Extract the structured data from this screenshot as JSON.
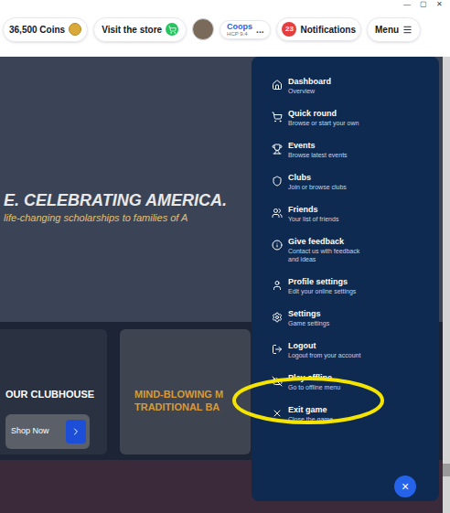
{
  "window_controls": [
    "—",
    "▢",
    "✕"
  ],
  "top_bar": {
    "coins": "36,500 Coins",
    "store": "Visit the store",
    "profile": {
      "name": "Coops",
      "handicap": "HCP 9.4",
      "more": "..."
    },
    "notifications": {
      "count": "23",
      "label": "Notifications"
    },
    "menu": "Menu"
  },
  "hero": {
    "title": "E. CELEBRATING AMERICA.",
    "subtitle": "life-changing scholarships to families of A"
  },
  "cards": [
    {
      "title": "OUR CLUBHOUSE",
      "button": "Shop Now"
    },
    {
      "lines": [
        "MIND-BLOWING M",
        "TRADITIONAL BA"
      ]
    }
  ],
  "menu_items": [
    {
      "title": "Dashboard",
      "description": "Overview",
      "highlighted": false
    },
    {
      "title": "Quick round",
      "description": "Browse or start your own",
      "highlighted": false
    },
    {
      "title": "Events",
      "description": "Browse latest events",
      "highlighted": false
    },
    {
      "title": "Clubs",
      "description": "Join or browse clubs",
      "highlighted": false
    },
    {
      "title": "Friends",
      "description": "Your list of friends",
      "highlighted": false
    },
    {
      "title": "Give feedback",
      "description": "Contact us with feedback and ideas",
      "highlighted": false
    },
    {
      "title": "Profile settings",
      "description": "Edit your online settings",
      "highlighted": false
    },
    {
      "title": "Settings",
      "description": "Game settings",
      "highlighted": false
    },
    {
      "title": "Logout",
      "description": "Logout from your account",
      "highlighted": false
    },
    {
      "title": "Play offline",
      "description": "Go to offline menu",
      "highlighted": true
    },
    {
      "title": "Exit game",
      "description": "Close the game",
      "highlighted": false
    }
  ],
  "close_button": "×"
}
